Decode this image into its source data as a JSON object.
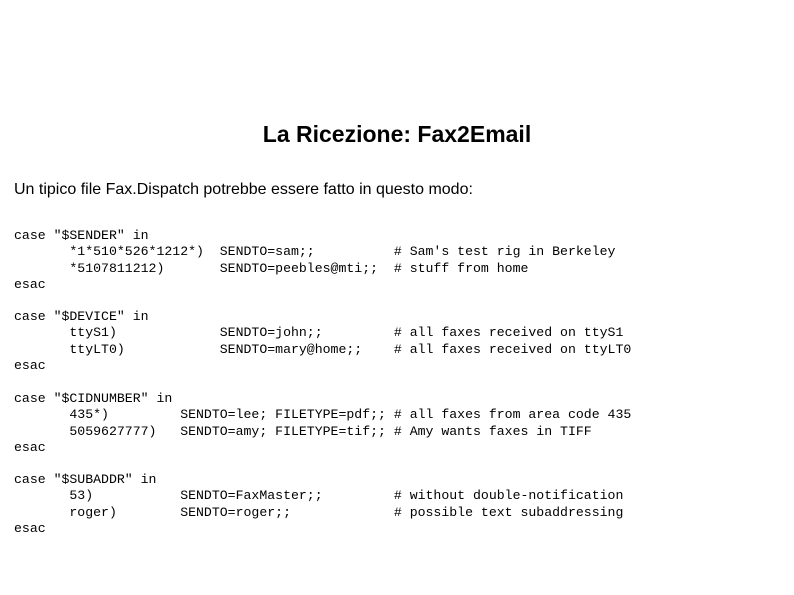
{
  "title": "La Ricezione: Fax2Email",
  "intro": "Un tipico file Fax.Dispatch potrebbe essere fatto in questo modo:",
  "blocks": [
    {
      "lines": [
        "case \"$SENDER\" in",
        "       *1*510*526*1212*)  SENDTO=sam;;          # Sam's test rig in Berkeley",
        "       *5107811212)       SENDTO=peebles@mti;;  # stuff from home",
        "esac"
      ]
    },
    {
      "lines": [
        "case \"$DEVICE\" in",
        "       ttyS1)             SENDTO=john;;         # all faxes received on ttyS1",
        "       ttyLT0)            SENDTO=mary@home;;    # all faxes received on ttyLT0",
        "esac"
      ]
    },
    {
      "lines": [
        "case \"$CIDNUMBER\" in",
        "       435*)         SENDTO=lee; FILETYPE=pdf;; # all faxes from area code 435",
        "       5059627777)   SENDTO=amy; FILETYPE=tif;; # Amy wants faxes in TIFF",
        "esac"
      ]
    },
    {
      "lines": [
        "case \"$SUBADDR\" in",
        "       53)           SENDTO=FaxMaster;;         # without double-notification",
        "       roger)        SENDTO=roger;;             # possible text subaddressing",
        "esac"
      ]
    }
  ]
}
